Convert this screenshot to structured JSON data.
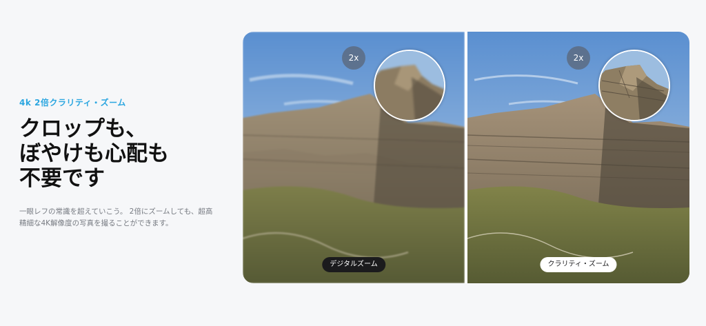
{
  "intro": {
    "eyebrow": "4k 2倍クラリティ・ズーム",
    "headline": [
      "クロップも、",
      "ぼやけも心配も",
      "不要です"
    ],
    "description": [
      "一眼レフの常識を超えていこう。 2倍にズームしても、超高",
      "精細な4K解像度の写真を撮ることができます。"
    ]
  },
  "comparison": {
    "left": {
      "zoom_badge": "2x",
      "label": "デジタルズーム"
    },
    "right": {
      "zoom_badge": "2x",
      "label": "クラリティ・ズーム"
    }
  },
  "colors": {
    "accent": "#2ba6e0",
    "sky_top": "#5f92cf",
    "sky_bottom": "#b9d0e6",
    "rock": "#8f8068",
    "vegetation": "#6f7a44"
  }
}
